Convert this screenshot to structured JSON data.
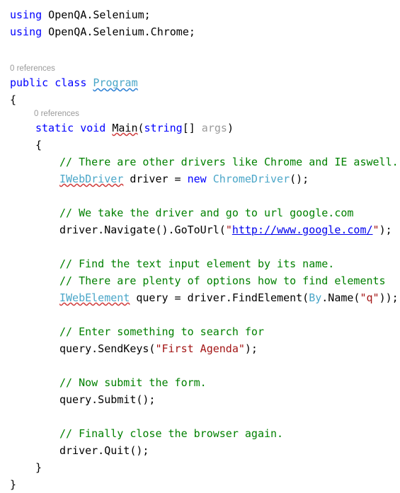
{
  "editor": {
    "language": "csharp",
    "colors": {
      "background": "#ffffff",
      "keyword": "#0000ff",
      "type": "#4aa6c8",
      "comment": "#008000",
      "string": "#a31515",
      "parameter": "#9b9b9b",
      "plain": "#000000",
      "codelens": "#9a9a9a",
      "hyperlink": "#0000ee",
      "squiggle_blue": "#2a7fd4",
      "squiggle_red": "#cf3b3b"
    },
    "codelens": {
      "class_program": "0 references",
      "method_main": "0 references"
    },
    "lines": {
      "using_1": {
        "keyword": "using",
        "namespace": " OpenQA.Selenium;"
      },
      "using_2": {
        "keyword": "using",
        "namespace": " OpenQA.Selenium.Chrome;"
      },
      "class_decl": {
        "kw_public": "public",
        "kw_class": "class",
        "name": "Program"
      },
      "brace_open_ns": "{",
      "method_decl": {
        "kw_static": "static",
        "kw_void": "void",
        "name": "Main",
        "paren_open": "(",
        "kw_string": "string",
        "brackets": "[]",
        "param": " args",
        "paren_close": ")"
      },
      "brace_open_class": "{",
      "comment_drivers": "// There are other drivers like Chrome and IE aswell.",
      "stmt_driver": {
        "type": "IWebDriver",
        "var": " driver = ",
        "kw_new": "new",
        "ctor": " ChromeDriver",
        "tail": "();"
      },
      "comment_url": "// We take the driver and go to url google.com",
      "stmt_navigate": {
        "head": "driver.Navigate().GoToUrl(",
        "quote_open": "\"",
        "url": "http://www.google.com/",
        "quote_close": "\"",
        "tail": ");"
      },
      "comment_find_1": "// Find the text input element by its name.",
      "comment_find_2": "// There are plenty of options how to find elements",
      "stmt_query": {
        "type": "IWebElement",
        "mid": " query = driver.FindElement(",
        "by": "By",
        "name_call": ".Name(",
        "quote_open": "\"",
        "arg": "q",
        "quote_close": "\"",
        "tail": "));"
      },
      "comment_enter": "// Enter something to search for",
      "stmt_sendkeys": {
        "head": "query.SendKeys(",
        "quote_open": "\"",
        "arg": "First Agenda",
        "quote_close": "\"",
        "tail": ");"
      },
      "comment_submit": "// Now submit the form.",
      "stmt_submit": "query.Submit();",
      "comment_close": "// Finally close the browser again.",
      "stmt_quit": "driver.Quit();",
      "brace_close_method": "}",
      "brace_close_class": "}"
    }
  }
}
